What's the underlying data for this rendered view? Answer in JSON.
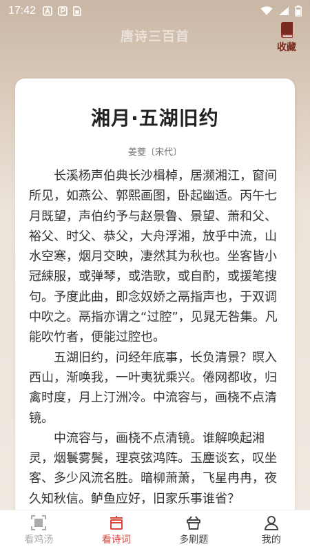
{
  "status_bar": {
    "time": "17:42"
  },
  "header": {
    "title": "唐诗三百首",
    "favorite_label": "收藏"
  },
  "poem": {
    "title": "湘月·五湖旧约",
    "author": "姜夔〔宋代〕",
    "paragraphs": [
      "长溪杨声伯典长沙楫棹，居濒湘江，窗间所见，如燕公、郭熙画图，卧起幽适。丙午七月既望，声伯约予与赵景鲁、景望、萧和父、裕父、时父、恭父，大舟浮湘，放乎中流，山水空寒，烟月交映，凄然其为秋也。坐客皆小冠綀服，或弹琴，或浩歌，或自酌，或援笔搜句。予度此曲，即念奴娇之鬲指声也，于双调中吹之。鬲指亦谓之“过腔”，见晁无咎集。凡能吹竹者，便能过腔也。",
      "五湖旧约，问经年底事，长负清景？暝入西山，渐唤我，一叶夷犹乘兴。倦网都收，归禽时度，月上汀洲冷。中流容与，画桡不点清镜。",
      "中流容与，画桡不点清镜。谁解唤起湘灵，烟鬟雾鬓，理哀弦鸿阵。玉麈谈玄，叹坐客、多少风流名胜。暗柳萧萧，飞星冉冉，夜久知秋信。鲈鱼应好，旧家乐事谁省？"
    ]
  },
  "tabs": [
    {
      "label": "看鸡汤",
      "icon": "frame-icon",
      "state": "dim"
    },
    {
      "label": "看诗词",
      "icon": "cake-icon",
      "state": "active"
    },
    {
      "label": "多刷题",
      "icon": "basket-icon",
      "state": "normal"
    },
    {
      "label": "我的",
      "icon": "user-icon",
      "state": "normal"
    }
  ],
  "colors": {
    "accent": "#d9453b",
    "favorite": "#7a2a1e"
  }
}
